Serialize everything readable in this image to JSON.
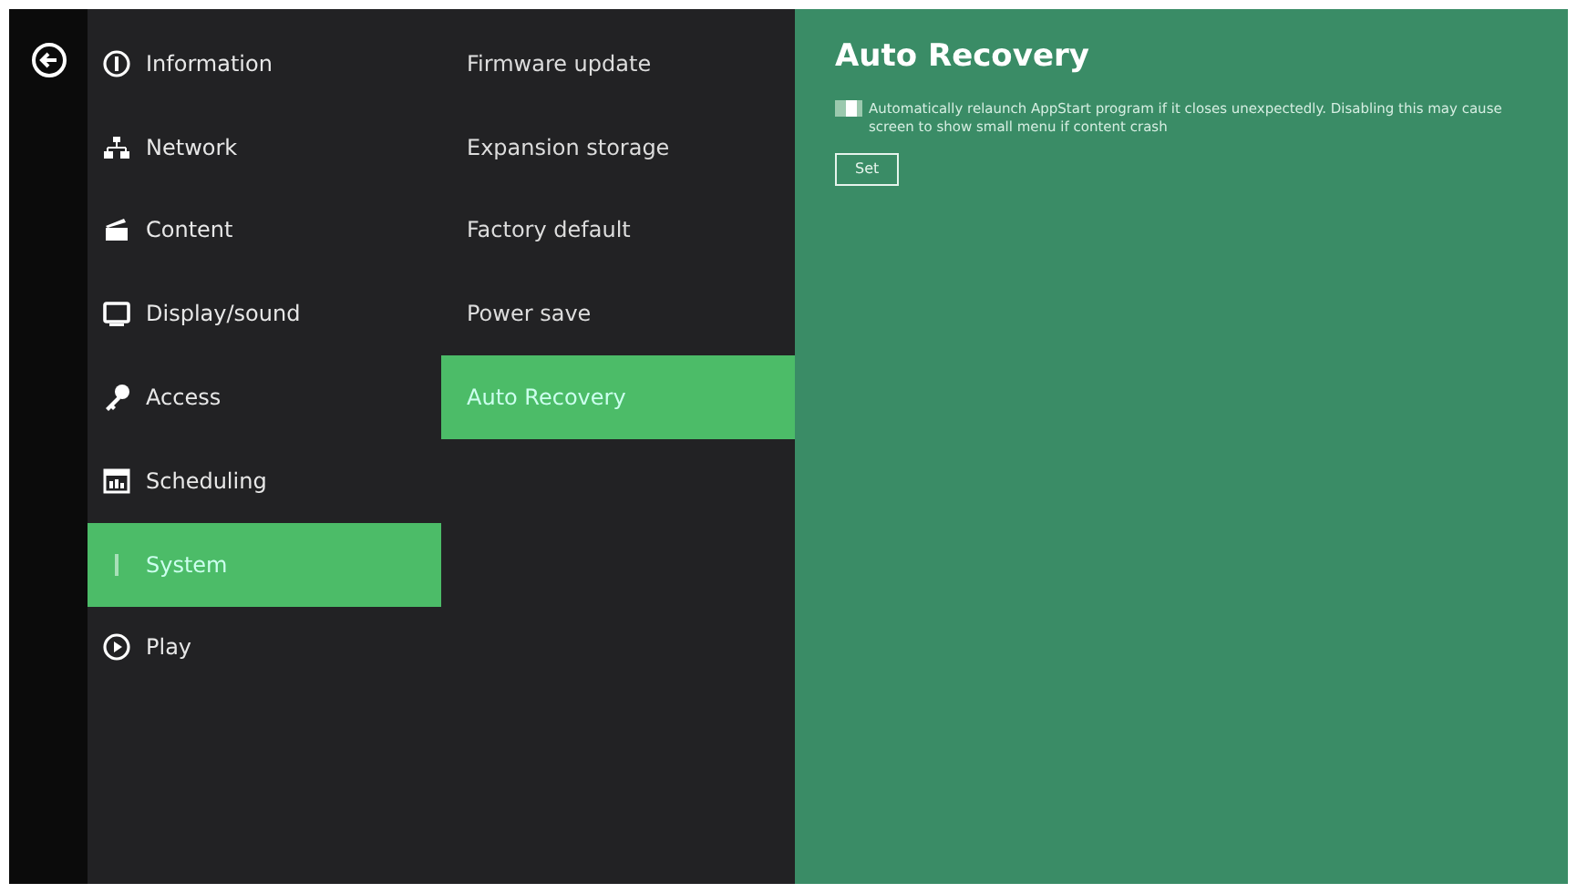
{
  "menu": [
    {
      "label": "Information",
      "kind": "info",
      "selected": false
    },
    {
      "label": "Network",
      "kind": "network",
      "selected": false
    },
    {
      "label": "Content",
      "kind": "content",
      "selected": false
    },
    {
      "label": "Display/sound",
      "kind": "display",
      "selected": false
    },
    {
      "label": "Access",
      "kind": "key",
      "selected": false
    },
    {
      "label": "Scheduling",
      "kind": "calendar",
      "selected": false
    },
    {
      "label": "System",
      "kind": "system",
      "selected": true
    },
    {
      "label": "Play",
      "kind": "play",
      "selected": false
    }
  ],
  "submenu": [
    {
      "label": "Firmware update",
      "selected": false
    },
    {
      "label": "Expansion storage",
      "selected": false
    },
    {
      "label": "Factory default",
      "selected": false
    },
    {
      "label": "Power save",
      "selected": false
    },
    {
      "label": "Auto Recovery",
      "selected": true
    }
  ],
  "panel": {
    "title": "Auto Recovery",
    "toggle": {
      "on": true,
      "description": "Automatically relaunch AppStart program if it closes unexpectedly. Disabling this may cause screen to show small menu if content crash"
    },
    "button": "Set"
  }
}
